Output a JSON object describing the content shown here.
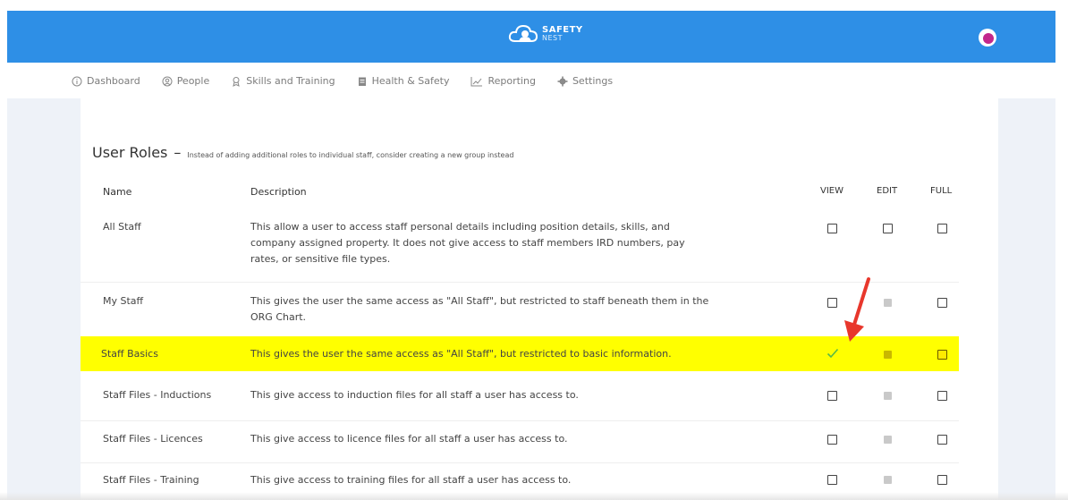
{
  "header": {
    "logo_line1": "SAFETY",
    "logo_line2": "NEST"
  },
  "nav": [
    {
      "label": "Dashboard",
      "icon": "info-circle-icon"
    },
    {
      "label": "People",
      "icon": "person-icon"
    },
    {
      "label": "Skills and Training",
      "icon": "badge-icon"
    },
    {
      "label": "Health & Safety",
      "icon": "clipboard-icon"
    },
    {
      "label": "Reporting",
      "icon": "line-chart-icon"
    },
    {
      "label": "Settings",
      "icon": "gear-icon"
    }
  ],
  "page": {
    "title": "User Roles",
    "dash": "–",
    "subtitle": "Instead of adding additional roles to individual staff, consider creating a new group instead"
  },
  "table": {
    "columns": [
      "Name",
      "Description",
      "VIEW",
      "EDIT",
      "FULL"
    ],
    "rows": [
      {
        "name": "All Staff",
        "desc_lines": [
          "This allow a user to access staff personal details including position details, skills, and",
          "company assigned property. It does not give access to staff members IRD numbers, pay",
          "rates, or sensitive file types."
        ],
        "view": "unchecked",
        "edit": "unchecked",
        "full": "unchecked"
      },
      {
        "name": "My Staff",
        "desc_lines": [
          "This gives the user the same access as \"All Staff\", but restricted to staff beneath them in the",
          "ORG Chart."
        ],
        "view": "unchecked",
        "edit": "disabled",
        "full": "unchecked"
      },
      {
        "name": "Staff Basics",
        "desc_lines": [
          "This gives the user the same access as \"All Staff\", but restricted to basic information."
        ],
        "view": "checked",
        "edit": "disabled",
        "full": "unchecked",
        "highlighted": true
      },
      {
        "name": "Staff Files - Inductions",
        "desc_lines": [
          "This give access to induction files for all staff a user has access to."
        ],
        "view": "unchecked",
        "edit": "disabled",
        "full": "unchecked"
      },
      {
        "name": "Staff Files - Licences",
        "desc_lines": [
          "This give access to licence files for all staff a user has access to."
        ],
        "view": "unchecked",
        "edit": "disabled",
        "full": "unchecked"
      },
      {
        "name": "Staff Files - Training",
        "desc_lines": [
          "This give access to training files for all staff a user has access to."
        ],
        "view": "unchecked",
        "edit": "disabled",
        "full": "unchecked"
      }
    ]
  },
  "colors": {
    "header_bg": "#2e8fe6",
    "highlight": "#ffff00",
    "arrow": "#e8372c",
    "check": "#58b947"
  }
}
